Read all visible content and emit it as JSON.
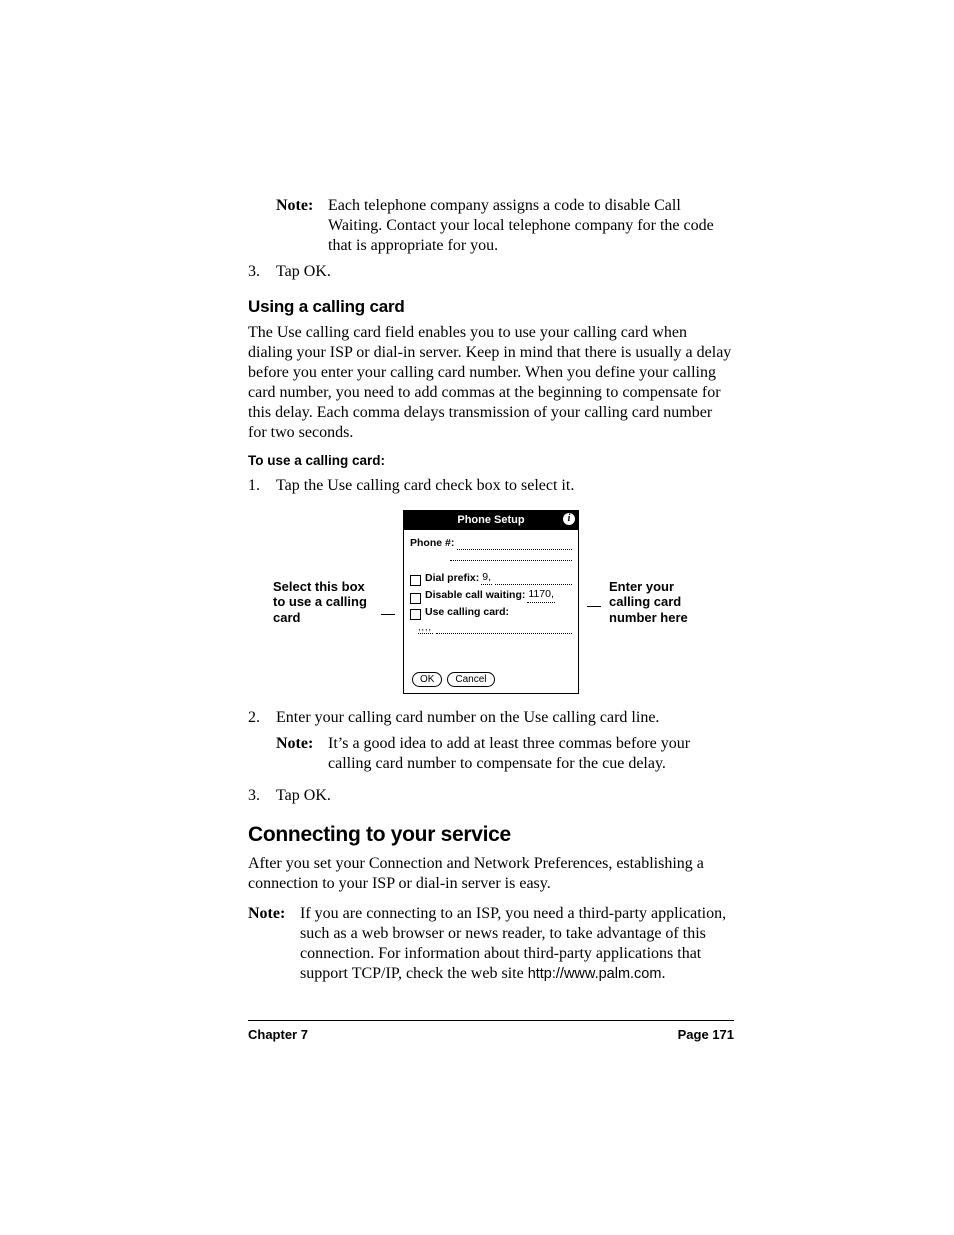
{
  "note1": {
    "label": "Note:",
    "text": "Each telephone company assigns a code to disable Call Waiting. Contact your local telephone company for the code that is appropriate for you."
  },
  "step3a": {
    "num": "3.",
    "text": "Tap OK."
  },
  "sec1": {
    "title": "Using a calling card",
    "para": "The Use calling card field enables you to use your calling card when dialing your ISP or dial-in server. Keep in mind that there is usually a delay before you enter your calling card number. When you define your calling card number, you need to add commas at the beginning to compensate for this delay. Each comma delays transmission of your calling card number for two seconds.",
    "subhead": "To use a calling card:",
    "step1": {
      "num": "1.",
      "text": "Tap the Use calling card check box to select it."
    },
    "step2": {
      "num": "2.",
      "text": "Enter your calling card number on the Use calling card line."
    },
    "step2note": {
      "label": "Note:",
      "text": "It’s a good idea to add at least three commas before your calling card number to compensate for the cue delay."
    },
    "step3": {
      "num": "3.",
      "text": "Tap OK."
    }
  },
  "figure": {
    "callout_left": "Select this box to use a calling card",
    "callout_right": "Enter your calling card number here",
    "title": "Phone Setup",
    "phone_label": "Phone #:",
    "dial_prefix_label": "Dial prefix:",
    "dial_prefix_value": "9,",
    "disable_cw_label": "Disable call waiting:",
    "disable_cw_value": "1170,",
    "use_cc_label": "Use calling card:",
    "commas": ",,,,",
    "ok": "OK",
    "cancel": "Cancel"
  },
  "sec2": {
    "title": "Connecting to your service",
    "para": "After you set your Connection and Network Preferences, establishing a connection to your ISP or dial-in server is easy.",
    "note": {
      "label": "Note:",
      "text": "If you are connecting to an ISP, you need a third-party application, such as a web browser or news reader, to take advantage of this connection. For information about third-party applications that support TCP/IP, check the web site ",
      "url": "http://www.palm.com",
      "tail": "."
    }
  },
  "footer": {
    "left": "Chapter 7",
    "right": "Page 171"
  }
}
